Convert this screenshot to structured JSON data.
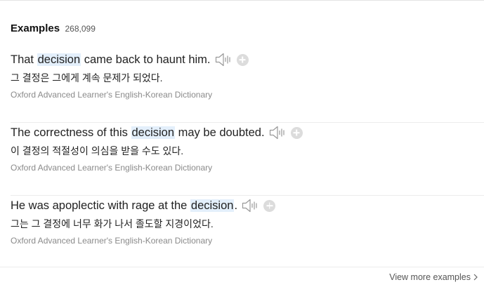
{
  "header": {
    "title": "Examples",
    "count": "268,099"
  },
  "examples": [
    {
      "before": "That ",
      "keyword": "decision",
      "after": " came back to haunt him.",
      "translation": "그 결정은 그에게 계속 문제가 되었다.",
      "source": "Oxford Advanced Learner's English-Korean Dictionary"
    },
    {
      "before": "The correctness of this ",
      "keyword": "decision",
      "after": " may be doubted.",
      "translation": "이 결정의 적절성이 의심을 받을 수도 있다.",
      "source": "Oxford Advanced Learner's English-Korean Dictionary"
    },
    {
      "before": "He was apoplectic with rage at the ",
      "keyword": "decision",
      "after": ".",
      "translation": "그는 그 결정에 너무 화가 나서 졸도할 지경이었다.",
      "source": "Oxford Advanced Learner's English-Korean Dictionary"
    }
  ],
  "footer": {
    "view_more_label": "View more examples"
  },
  "colors": {
    "highlight": "#e3effb",
    "text": "#222222",
    "source_text": "#8a8a8a",
    "icon_gray": "#999999",
    "add_button_bg": "#dcdcdc"
  },
  "icons": {
    "speaker": "speaker-icon",
    "add": "add-icon",
    "chevron": "chevron-right-icon"
  }
}
